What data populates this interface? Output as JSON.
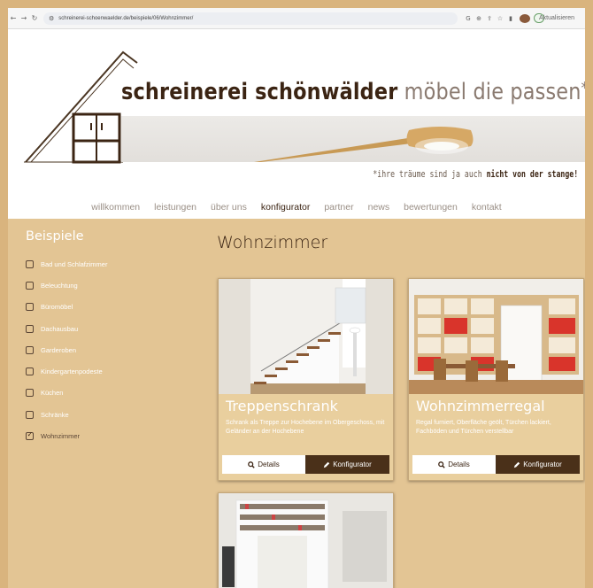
{
  "browser": {
    "url": "schreinerei-schoenwaelder.de/beispiele/06/Wohnzimmer/",
    "update_label": "Aktualisieren"
  },
  "header": {
    "brand_part1": "schreinerei schönwälder",
    "brand_part2": "möbel die passen",
    "brand_star": "*",
    "slogan_part1": "*ihre träume sind ja auch ",
    "slogan_part2": "nicht von der stange!"
  },
  "menu": {
    "items": [
      "willkommen",
      "leistungen",
      "über uns",
      "konfigurator",
      "partner",
      "news",
      "bewertungen",
      "kontakt"
    ],
    "active": "konfigurator"
  },
  "sidebar": {
    "title": "Beispiele",
    "items": [
      {
        "label": "Bad und Schlafzimmer",
        "checked": false
      },
      {
        "label": "Beleuchtung",
        "checked": false
      },
      {
        "label": "Büromöbel",
        "checked": false
      },
      {
        "label": "Dachausbau",
        "checked": false
      },
      {
        "label": "Garderoben",
        "checked": false
      },
      {
        "label": "Kindergartenpodeste",
        "checked": false
      },
      {
        "label": "Küchen",
        "checked": false
      },
      {
        "label": "Schränke",
        "checked": false
      },
      {
        "label": "Wohnzimmer",
        "checked": true
      }
    ]
  },
  "main": {
    "title": "Wohnzimmer",
    "cards": [
      {
        "title": "Treppenschrank",
        "description": "Schrank als Treppe zur Hochebene im Obergeschoss, mit Geländer an der Hochebene",
        "details_label": "Details",
        "config_label": "Konfigurator"
      },
      {
        "title": "Wohnzimmerregal",
        "description": "Regal furniert, Oberfläche geölt, Türchen lackiert, Fachböden und Türchen verstellbar",
        "details_label": "Details",
        "config_label": "Konfigurator"
      }
    ]
  },
  "colors": {
    "brand_dark": "#3b2413",
    "wood_bg": "#e3c594",
    "button_dark": "#4a3019"
  }
}
